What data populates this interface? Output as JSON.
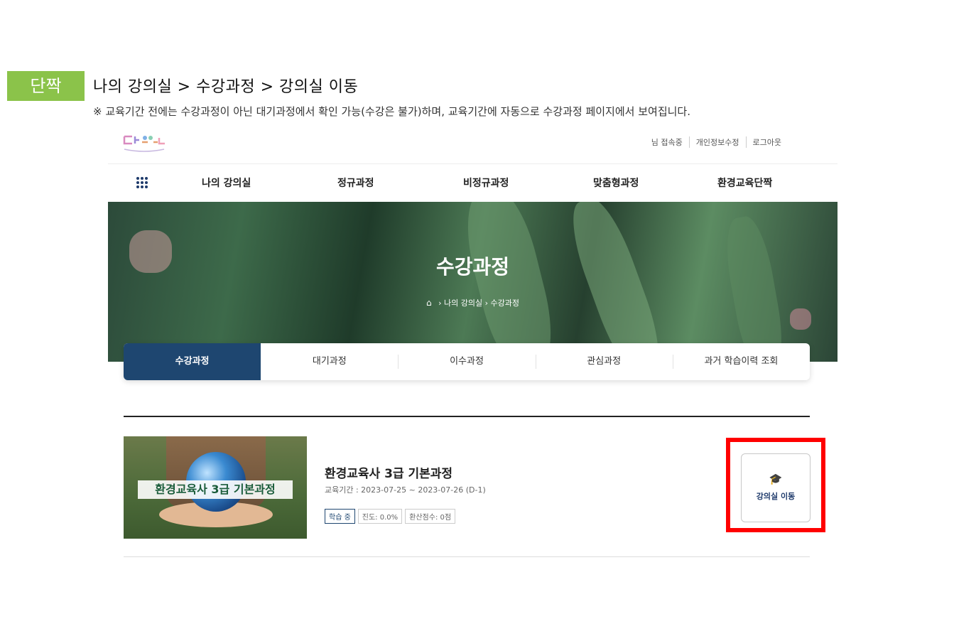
{
  "guide": {
    "badge": "단짝",
    "path": "나의 강의실 > 수강과정 > 강의실 이동",
    "note": "※ 교육기간 전에는 수강과정이 아닌 대기과정에서 확인 가능(수강은 불가)하며, 교육기간에 자동으로 수강과정 페이지에서 보여집니다."
  },
  "header": {
    "utility": [
      "님 접속중",
      "개인정보수정",
      "로그아웃"
    ]
  },
  "gnb": {
    "menu_icon": "grid-icon",
    "items": [
      "나의 강의실",
      "정규과정",
      "비정규과정",
      "맞춤형과정",
      "환경교육단짝"
    ]
  },
  "hero": {
    "title": "수강과정",
    "breadcrumb": [
      "나의 강의실",
      "수강과정"
    ]
  },
  "tabs": [
    "수강과정",
    "대기과정",
    "이수과정",
    "관심과정",
    "과거 학습이력 조회"
  ],
  "course": {
    "thumb_label": "환경교육사 3급 기본과정",
    "title": "환경교육사 3급 기본과정",
    "period": "교육기간 : 2023-07-25 ~ 2023-07-26 (D-1)",
    "status": "학습 중",
    "progress": "진도: 0.0%",
    "score": "환산점수: 0점",
    "action_label": "강의실 이동",
    "action_icon": "graduation-cap-icon"
  },
  "colors": {
    "badge_bg": "#8bc34a",
    "primary": "#1e4670",
    "highlight": "#ff0000"
  }
}
